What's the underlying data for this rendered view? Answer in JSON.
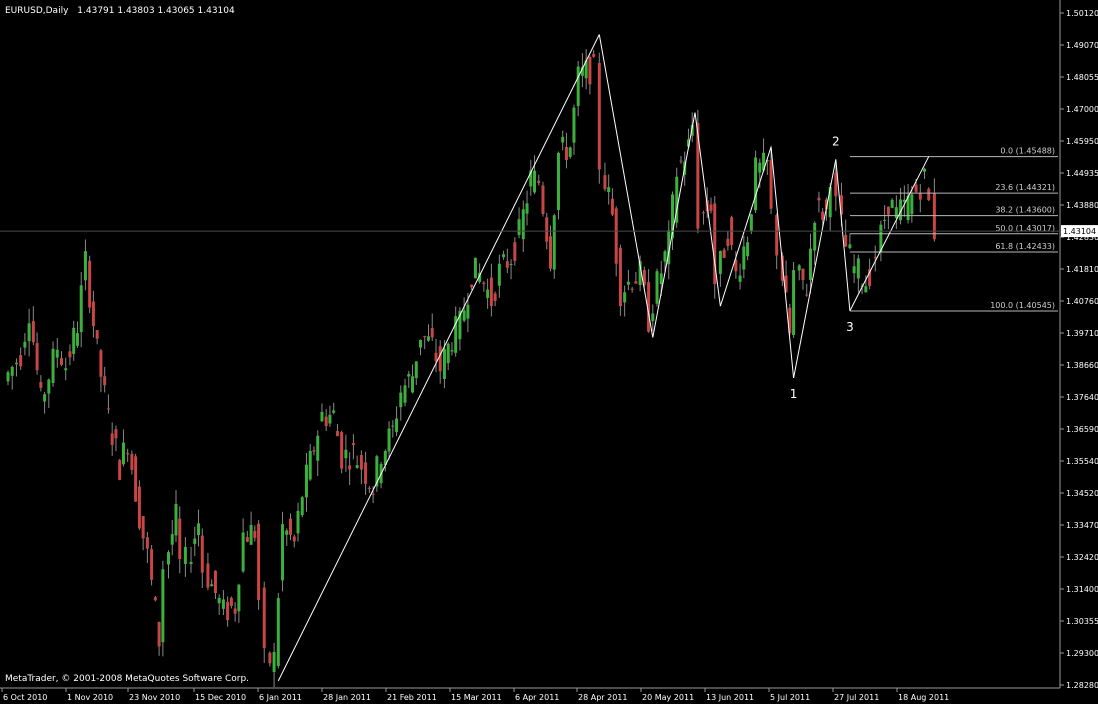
{
  "header": {
    "symbol": "EURUSD,Daily",
    "ohlc": "1.43791 1.43803 1.43065 1.43104"
  },
  "footer": {
    "copyright": "MetaTrader, © 2001-2008 MetaQuotes Software Corp."
  },
  "colors": {
    "background": "#000000",
    "bull": "#3cb03c",
    "bear": "#c84646",
    "axis": "#9a9a9a",
    "text": "#ffffff",
    "lines": "#ffffff"
  },
  "chart_data": {
    "type": "candlestick",
    "symbol": "EURUSD",
    "timeframe": "Daily",
    "y_ticks": [
      "1.50120",
      "1.49070",
      "1.48055",
      "1.47000",
      "1.45950",
      "1.44935",
      "1.43880",
      "1.42830",
      "1.41810",
      "1.40760",
      "1.39710",
      "1.38660",
      "1.37640",
      "1.36590",
      "1.35540",
      "1.34520",
      "1.33470",
      "1.32420",
      "1.31400",
      "1.30355",
      "1.29300",
      "1.28280"
    ],
    "ylim": [
      1.2828,
      1.5012
    ],
    "current_price": "1.43104",
    "x_ticks": [
      "6 Oct 2010",
      "1 Nov 2010",
      "23 Nov 2010",
      "15 Dec 2010",
      "6 Jan 2011",
      "28 Jan 2011",
      "21 Feb 2011",
      "15 Mar 2011",
      "6 Apr 2011",
      "28 Apr 2011",
      "20 May 2011",
      "13 Jun 2011",
      "5 Jul 2011",
      "27 Jul 2011",
      "18 Aug 2011"
    ],
    "swing_points": [
      {
        "date": "2011-01-10",
        "price": 1.287
      },
      {
        "date": "2011-05-04",
        "price": 1.494
      },
      {
        "date": "2011-05-23",
        "price": 1.397
      },
      {
        "date": "2011-06-07",
        "price": 1.469
      },
      {
        "date": "2011-06-16",
        "price": 1.407
      },
      {
        "date": "2011-07-04",
        "price": 1.458
      },
      {
        "date": "2011-07-12",
        "price": 1.384
      },
      {
        "date": "2011-07-27",
        "price": 1.454
      },
      {
        "date": "2011-08-01",
        "price": 1.4055
      },
      {
        "date": "2011-08-29",
        "price": 1.4549
      }
    ],
    "wave_labels": [
      {
        "text": "1",
        "date": "2011-07-12",
        "price": 1.384
      },
      {
        "text": "2",
        "date": "2011-07-27",
        "price": 1.454
      },
      {
        "text": "3",
        "date": "2011-08-01",
        "price": 1.4055
      }
    ],
    "fibonacci": {
      "from_date": "2011-08-01",
      "to_date": "2011-09-02",
      "levels": [
        {
          "label": "0.0 (1.45488)",
          "price": 1.45488
        },
        {
          "label": "23.6 (1.44321)",
          "price": 1.44321
        },
        {
          "label": "38.2 (1.43600)",
          "price": 1.436
        },
        {
          "label": "50.0 (1.43017)",
          "price": 1.43017
        },
        {
          "label": "61.8 (1.42433)",
          "price": 1.42433
        },
        {
          "label": "100.0 (1.40545)",
          "price": 1.40545
        }
      ]
    },
    "close_path": [
      [
        "2010-10-06",
        1.383
      ],
      [
        "2010-10-12",
        1.392
      ],
      [
        "2010-10-15",
        1.406
      ],
      [
        "2010-10-19",
        1.376
      ],
      [
        "2010-10-25",
        1.394
      ],
      [
        "2010-10-28",
        1.388
      ],
      [
        "2010-11-01",
        1.401
      ],
      [
        "2010-11-04",
        1.421
      ],
      [
        "2010-11-08",
        1.392
      ],
      [
        "2010-11-12",
        1.371
      ],
      [
        "2010-11-16",
        1.356
      ],
      [
        "2010-11-19",
        1.364
      ],
      [
        "2010-11-23",
        1.34
      ],
      [
        "2010-11-26",
        1.327
      ],
      [
        "2010-11-30",
        1.3
      ],
      [
        "2010-12-02",
        1.324
      ],
      [
        "2010-12-06",
        1.339
      ],
      [
        "2010-12-08",
        1.324
      ],
      [
        "2010-12-10",
        1.325
      ],
      [
        "2010-12-14",
        1.338
      ],
      [
        "2010-12-16",
        1.323
      ],
      [
        "2010-12-20",
        1.315
      ],
      [
        "2010-12-23",
        1.309
      ],
      [
        "2010-12-27",
        1.311
      ],
      [
        "2010-12-30",
        1.334
      ],
      [
        "2011-01-03",
        1.335
      ],
      [
        "2011-01-05",
        1.313
      ],
      [
        "2011-01-07",
        1.293
      ],
      [
        "2011-01-10",
        1.294
      ],
      [
        "2011-01-13",
        1.336
      ],
      [
        "2011-01-17",
        1.331
      ],
      [
        "2011-01-20",
        1.347
      ],
      [
        "2011-01-24",
        1.362
      ],
      [
        "2011-01-27",
        1.372
      ],
      [
        "2011-01-31",
        1.372
      ],
      [
        "2011-02-03",
        1.359
      ],
      [
        "2011-02-07",
        1.36
      ],
      [
        "2011-02-10",
        1.356
      ],
      [
        "2011-02-14",
        1.349
      ],
      [
        "2011-02-17",
        1.36
      ],
      [
        "2011-02-21",
        1.367
      ],
      [
        "2011-02-24",
        1.38
      ],
      [
        "2011-02-28",
        1.385
      ],
      [
        "2011-03-03",
        1.398
      ],
      [
        "2011-03-07",
        1.394
      ],
      [
        "2011-03-10",
        1.387
      ],
      [
        "2011-03-14",
        1.397
      ],
      [
        "2011-03-17",
        1.401
      ],
      [
        "2011-03-21",
        1.418
      ],
      [
        "2011-03-24",
        1.417
      ],
      [
        "2011-03-28",
        1.409
      ],
      [
        "2011-03-31",
        1.418
      ],
      [
        "2011-04-04",
        1.423
      ],
      [
        "2011-04-07",
        1.43
      ],
      [
        "2011-04-11",
        1.448
      ],
      [
        "2011-04-14",
        1.447
      ],
      [
        "2011-04-18",
        1.423
      ],
      [
        "2011-04-21",
        1.456
      ],
      [
        "2011-04-25",
        1.458
      ],
      [
        "2011-04-28",
        1.48
      ],
      [
        "2011-05-02",
        1.483
      ],
      [
        "2011-05-04",
        1.482
      ],
      [
        "2011-05-06",
        1.453
      ],
      [
        "2011-05-10",
        1.436
      ],
      [
        "2011-05-13",
        1.412
      ],
      [
        "2011-05-17",
        1.416
      ],
      [
        "2011-05-20",
        1.417
      ],
      [
        "2011-05-23",
        1.403
      ],
      [
        "2011-05-26",
        1.414
      ],
      [
        "2011-05-30",
        1.427
      ],
      [
        "2011-06-02",
        1.45
      ],
      [
        "2011-06-06",
        1.458
      ],
      [
        "2011-06-08",
        1.465
      ],
      [
        "2011-06-10",
        1.435
      ],
      [
        "2011-06-14",
        1.44
      ],
      [
        "2011-06-16",
        1.415
      ],
      [
        "2011-06-20",
        1.431
      ],
      [
        "2011-06-23",
        1.417
      ],
      [
        "2011-06-27",
        1.43
      ],
      [
        "2011-06-30",
        1.45
      ],
      [
        "2011-07-04",
        1.452
      ],
      [
        "2011-07-06",
        1.436
      ],
      [
        "2011-07-08",
        1.426
      ],
      [
        "2011-07-12",
        1.398
      ],
      [
        "2011-07-14",
        1.417
      ],
      [
        "2011-07-18",
        1.413
      ],
      [
        "2011-07-21",
        1.438
      ],
      [
        "2011-07-25",
        1.437
      ],
      [
        "2011-07-27",
        1.45
      ],
      [
        "2011-07-29",
        1.439
      ],
      [
        "2011-08-01",
        1.426
      ],
      [
        "2011-08-04",
        1.419
      ],
      [
        "2011-08-08",
        1.415
      ],
      [
        "2011-08-10",
        1.418
      ],
      [
        "2011-08-12",
        1.424
      ],
      [
        "2011-08-16",
        1.441
      ],
      [
        "2011-08-19",
        1.436
      ],
      [
        "2011-08-23",
        1.44
      ],
      [
        "2011-08-26",
        1.444
      ],
      [
        "2011-08-29",
        1.448
      ],
      [
        "2011-08-31",
        1.44
      ],
      [
        "2011-09-02",
        1.431
      ]
    ]
  }
}
